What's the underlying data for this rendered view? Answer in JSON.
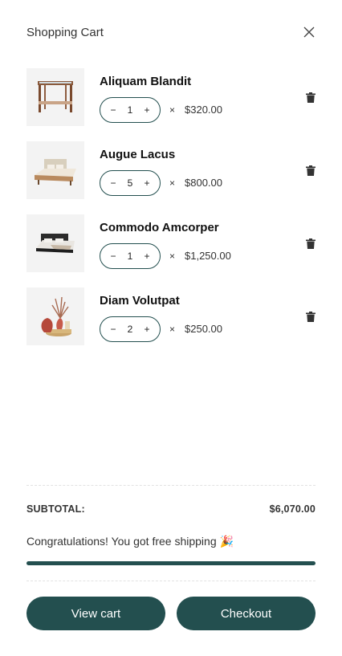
{
  "header": {
    "title": "Shopping Cart"
  },
  "items": [
    {
      "name": "Aliquam Blandit",
      "qty": "1",
      "price": "$320.00",
      "minus": "−",
      "plus": "+",
      "times": "×"
    },
    {
      "name": "Augue Lacus",
      "qty": "5",
      "price": "$800.00",
      "minus": "−",
      "plus": "+",
      "times": "×"
    },
    {
      "name": "Commodo Amcorper",
      "qty": "1",
      "price": "$1,250.00",
      "minus": "−",
      "plus": "+",
      "times": "×"
    },
    {
      "name": "Diam Volutpat",
      "qty": "2",
      "price": "$250.00",
      "minus": "−",
      "plus": "+",
      "times": "×"
    }
  ],
  "summary": {
    "subtotal_label": "SUBTOTAL:",
    "subtotal_value": "$6,070.00",
    "shipping_message": "Congratulations! You got free shipping 🎉",
    "shipping_progress": 1.0
  },
  "actions": {
    "view_cart": "View cart",
    "checkout": "Checkout"
  },
  "colors": {
    "accent": "#234f4f"
  },
  "icons": [
    "close-icon",
    "trash-icon",
    "minus-icon",
    "plus-icon"
  ]
}
